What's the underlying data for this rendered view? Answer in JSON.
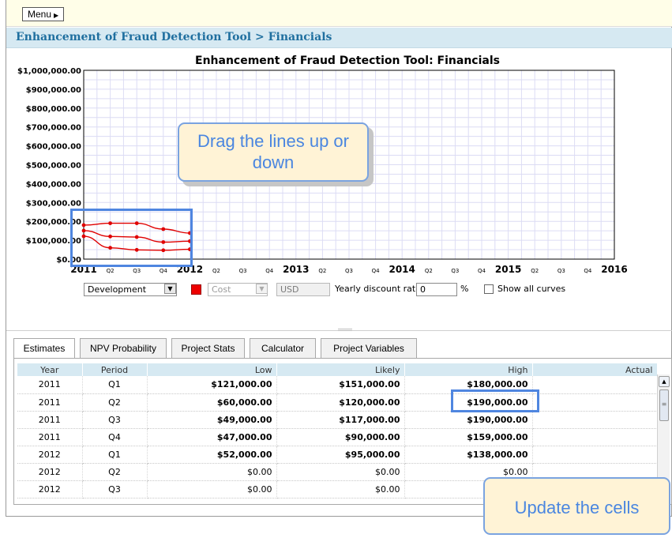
{
  "menu": {
    "label": "Menu",
    "arrow_icon": "triangle-right-icon"
  },
  "breadcrumb": {
    "project": "Enhancement of Fraud Detection Tool",
    "separator": ">",
    "page": "Financials"
  },
  "chart_data": {
    "type": "line",
    "title": "Enhancement of Fraud Detection Tool: Financials",
    "ylabel": "",
    "xlabel": "",
    "ylim": [
      0,
      1000000
    ],
    "y_ticks": [
      "$1,000,000.00",
      "$900,000.00",
      "$800,000.00",
      "$700,000.00",
      "$600,000.00",
      "$500,000.00",
      "$400,000.00",
      "$300,000.00",
      "$200,000.00",
      "$100,000.00",
      "$0.00"
    ],
    "x_ticks": [
      "2011",
      "Q2",
      "Q3",
      "Q4",
      "2012",
      "Q2",
      "Q3",
      "Q4",
      "2013",
      "Q2",
      "Q3",
      "Q4",
      "2014",
      "Q2",
      "Q3",
      "Q4",
      "2015",
      "Q2",
      "Q3",
      "Q4",
      "2016"
    ],
    "grid": true,
    "legend": "none",
    "series": [
      {
        "values": [
          180000,
          190000,
          190000,
          159000,
          138000
        ],
        "color": "#e00000"
      },
      {
        "values": [
          151000,
          120000,
          117000,
          90000,
          95000
        ],
        "color": "#e00000"
      },
      {
        "values": [
          121000,
          60000,
          49000,
          47000,
          52000
        ],
        "color": "#e00000"
      }
    ]
  },
  "controls": {
    "phase": "Development",
    "series_color": "#ee0000",
    "measure": "Cost",
    "currency": "USD",
    "discount_label": "Yearly discount rate",
    "discount_value": "0",
    "percent": "%",
    "show_all_label": "Show all curves",
    "dropdown_icon": "chevron-down-icon"
  },
  "tabs": [
    "Estimates",
    "NPV Probability",
    "Project Stats",
    "Calculator",
    "Project Variables"
  ],
  "table": {
    "headers": [
      "Year",
      "Period",
      "Low",
      "Likely",
      "High",
      "Actual"
    ],
    "rows": [
      [
        "2011",
        "Q1",
        "$121,000.00",
        "$151,000.00",
        "$180,000.00",
        ""
      ],
      [
        "2011",
        "Q2",
        "$60,000.00",
        "$120,000.00",
        "$190,000.00",
        ""
      ],
      [
        "2011",
        "Q3",
        "$49,000.00",
        "$117,000.00",
        "$190,000.00",
        ""
      ],
      [
        "2011",
        "Q4",
        "$47,000.00",
        "$90,000.00",
        "$159,000.00",
        ""
      ],
      [
        "2012",
        "Q1",
        "$52,000.00",
        "$95,000.00",
        "$138,000.00",
        ""
      ],
      [
        "2012",
        "Q2",
        "$0.00",
        "$0.00",
        "$0.00",
        ""
      ],
      [
        "2012",
        "Q3",
        "$0.00",
        "$0.00",
        "",
        ""
      ]
    ]
  },
  "callouts": {
    "drag": "Drag the lines up or down",
    "update": "Update the cells"
  },
  "accent": "#4f86e0"
}
